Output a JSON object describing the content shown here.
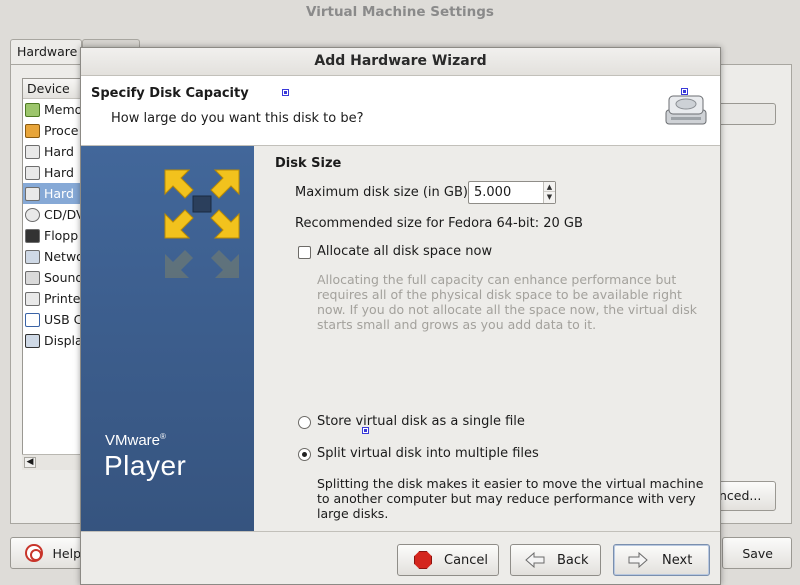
{
  "background_window": {
    "title": "Virtual Machine Settings",
    "tab_hardware": "Hardware",
    "device_header": "Device",
    "devices": [
      "Memo",
      "Proce",
      "Hard",
      "Hard",
      "Hard",
      "CD/DV",
      "Flopp",
      "Netwo",
      "Sound",
      "Printe",
      "USB C",
      "Displa"
    ],
    "selected_device_index": 4,
    "advanced_button": "nced...",
    "help_button": "Help",
    "save_button": "Save"
  },
  "wizard": {
    "title": "Add Hardware Wizard",
    "header_title": "Specify Disk Capacity",
    "header_subtitle": "How large do you want this disk to be?",
    "brand": "VMware",
    "brand_mark": "®",
    "product": "Player",
    "section_title": "Disk Size",
    "max_size_label": "Maximum disk size (in GB):",
    "max_size_value": "5.000",
    "recommended": "Recommended size for Fedora 64-bit: 20 GB",
    "allocate_label": "Allocate all disk space now",
    "allocate_checked": false,
    "allocate_desc": "Allocating the full capacity can enhance performance but requires all of the physical disk space to be available right now. If you do not allocate all the space now, the virtual disk starts small and grows as you add data to it.",
    "single_file_label": "Store virtual disk as a single file",
    "multi_file_label": "Split virtual disk into multiple files",
    "selected_option": "multi_file",
    "split_desc": "Splitting the disk makes it easier to move the virtual machine to another computer but may reduce performance with very large disks.",
    "cancel_button": "Cancel",
    "back_button": "Back",
    "next_button": "Next"
  },
  "colors": {
    "banner": "#3d5f8f",
    "logo_yellow": "#f2c21d",
    "cancel_red": "#d4261e"
  }
}
